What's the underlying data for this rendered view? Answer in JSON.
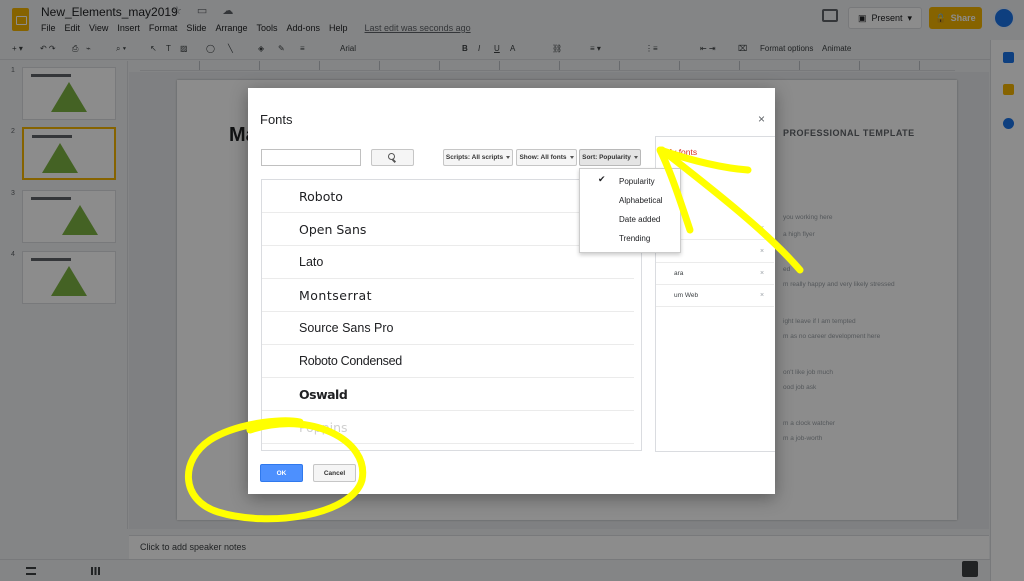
{
  "app": {
    "doc_title": "New_Elements_may2019",
    "menu": [
      "File",
      "Edit",
      "View",
      "Insert",
      "Format",
      "Slide",
      "Arrange",
      "Tools",
      "Add-ons",
      "Help"
    ],
    "last_edit": "Last edit was seconds ago",
    "present_label": "Present",
    "share_label": "Share",
    "brand_color": "#f4b400"
  },
  "toolbar": {
    "font_name": "Arial",
    "format_options": "Format options",
    "animate": "Animate"
  },
  "filmstrip": {
    "slide_numbers": [
      "1",
      "2",
      "3",
      "4"
    ]
  },
  "slide": {
    "title_fragment": "Ma",
    "template_label": "PROFESSIONAL TEMPLATE",
    "lines": [
      "you working here",
      "a high flyer",
      "ed",
      "m really happy and very likely stressed",
      "ight leave if I am tempted",
      "m as no career development here",
      "on't like job much",
      "ood job ask",
      "m a clock watcher",
      "m a job-worth"
    ]
  },
  "notes": {
    "placeholder": "Click to add speaker notes"
  },
  "dialog": {
    "title": "Fonts",
    "close_glyph": "×",
    "search_placeholder": "",
    "filters": {
      "scripts": "Scripts: All scripts",
      "show": "Show: All fonts",
      "sort": "Sort: Popularity"
    },
    "fonts": [
      "Roboto",
      "Open Sans",
      "Lato",
      "Montserrat",
      "Source Sans Pro",
      "Roboto Condensed",
      "Oswald",
      "Poppins"
    ],
    "my_fonts_title": "My fonts",
    "my_fonts": [
      "Pr",
      "",
      "ara",
      "um Web"
    ],
    "remove_glyph": "×",
    "ok_label": "OK",
    "cancel_label": "Cancel"
  },
  "sort_menu": {
    "check_glyph": "✔",
    "items": [
      "Popularity",
      "Alphabetical",
      "Date added",
      "Trending"
    ],
    "selected": "Popularity"
  },
  "annotation_color": "#ffff00"
}
